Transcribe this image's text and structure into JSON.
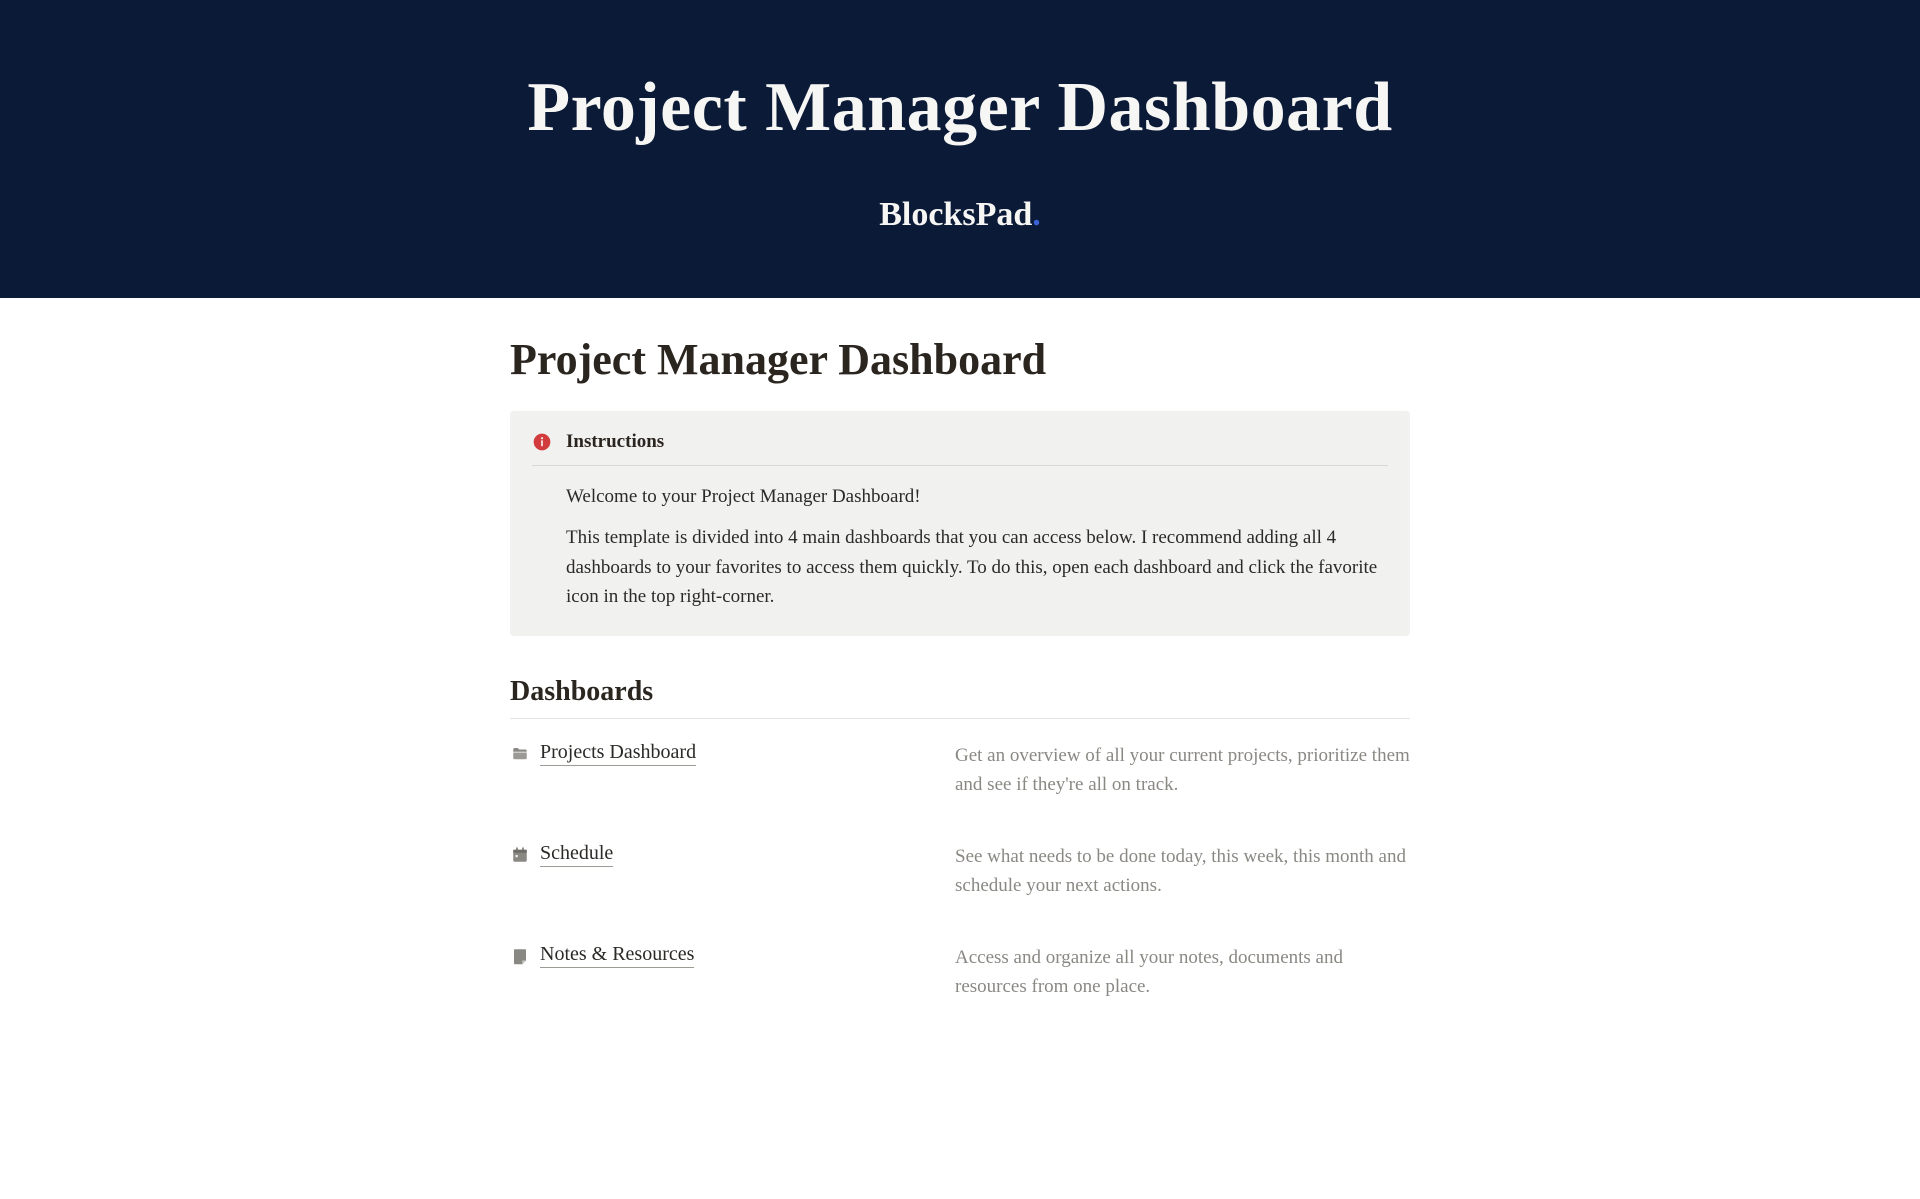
{
  "hero": {
    "title": "Project Manager Dashboard",
    "brand": "BlocksPad",
    "brand_dot": "."
  },
  "page": {
    "title": "Project Manager Dashboard"
  },
  "instructions": {
    "label": "Instructions",
    "welcome": "Welcome to your Project Manager Dashboard!",
    "body": "This template is divided into 4 main dashboards that you can access below. I recommend adding all 4 dashboards to your favorites to access them quickly. To do this, open each dashboard and click the favorite icon in the top right-corner."
  },
  "dashboards": {
    "heading": "Dashboards",
    "items": [
      {
        "icon": "folder",
        "title": "Projects Dashboard",
        "description": "Get an overview of all your current projects, prioritize them and see if they're all on track."
      },
      {
        "icon": "calendar",
        "title": "Schedule",
        "description": "See what needs to be done today, this week, this month and schedule your next actions."
      },
      {
        "icon": "note",
        "title": "Notes & Resources",
        "description": "Access and organize all your notes, documents and resources from one place."
      }
    ]
  }
}
